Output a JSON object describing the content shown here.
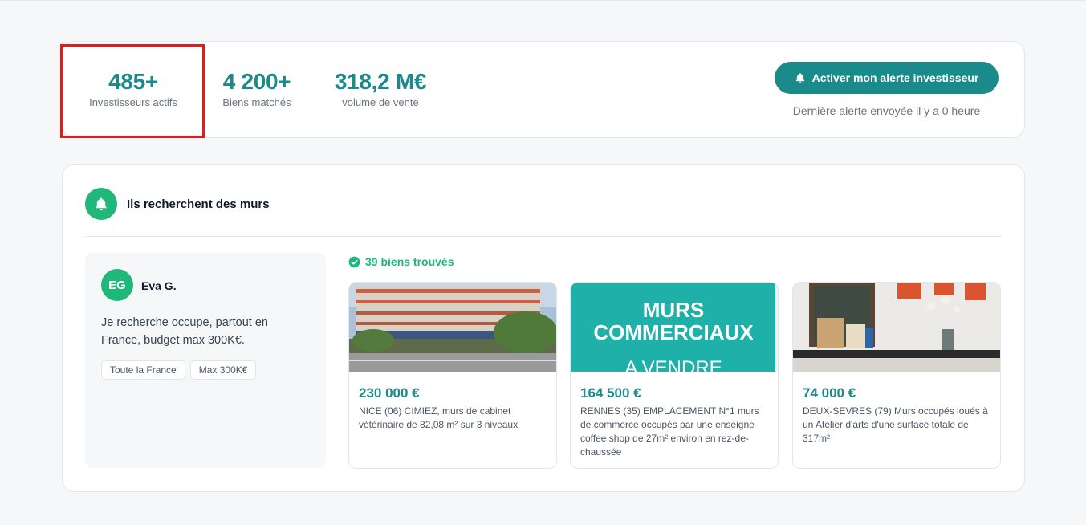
{
  "stats": [
    {
      "value": "485+",
      "label": "Investisseurs actifs"
    },
    {
      "value": "4 200+",
      "label": "Biens matchés"
    },
    {
      "value": "318,2 M€",
      "label": "volume de vente"
    }
  ],
  "alert": {
    "button_label": "Activer mon alerte investisseur",
    "last_alert": "Dernière alerte envoyée il y a 0 heure"
  },
  "section": {
    "title": "Ils recherchent des murs"
  },
  "investor": {
    "initials": "EG",
    "name": "Eva G.",
    "description": "Je recherche occupe, partout en France, budget max 300K€.",
    "tags": [
      "Toute la France",
      "Max 300K€"
    ]
  },
  "found": {
    "label": "39 biens trouvés"
  },
  "properties": [
    {
      "price": "230 000 €",
      "description": "NICE (06) CIMIEZ, murs de cabinet vétérinaire de 82,08 m² sur 3 niveaux"
    },
    {
      "price": "164 500 €",
      "description": "RENNES (35) EMPLACEMENT N°1 murs de commerce occupés par une enseigne coffee shop de 27m² environ en rez-de-chaussée",
      "image_text": [
        "MURS",
        "COMMERCIAUX",
        "A VENDRE"
      ]
    },
    {
      "price": "74 000 €",
      "description": "DEUX-SEVRES (79) Murs occupés loués à un Atelier d'arts d'une surface totale de 317m²"
    }
  ],
  "colors": {
    "teal": "#1b8a8a",
    "green": "#1fb87a",
    "highlight": "#d72020"
  }
}
